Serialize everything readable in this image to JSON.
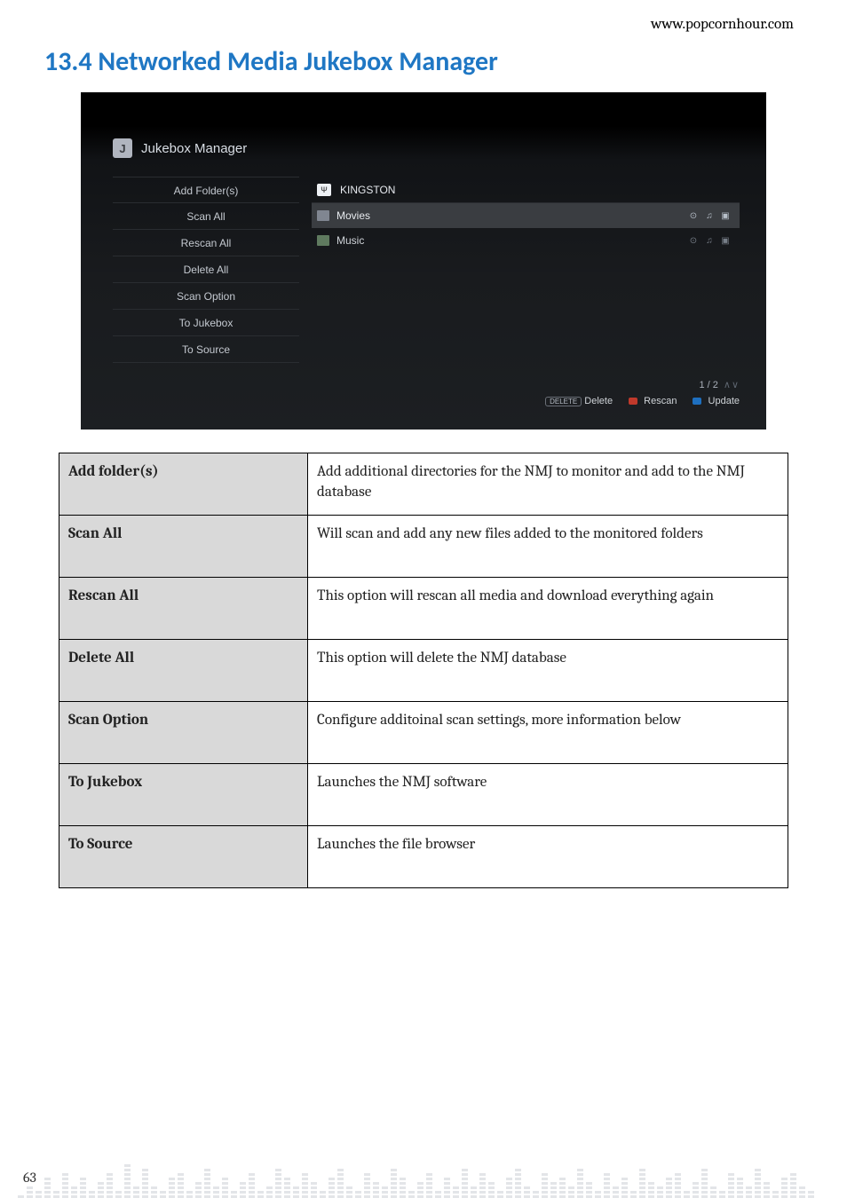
{
  "header": {
    "url": "www.popcornhour.com"
  },
  "section": {
    "heading": "13.4 Networked Media Jukebox Manager"
  },
  "screenshot": {
    "app_icon_letter": "J",
    "app_title": "Jukebox Manager",
    "menu": [
      "Add Folder(s)",
      "Scan All",
      "Rescan All",
      "Delete All",
      "Scan Option",
      "To Jukebox",
      "To Source"
    ],
    "drive": {
      "name": "KINGSTON"
    },
    "folders": [
      {
        "name": "Movies",
        "selected": true,
        "icons": [
          "video",
          "music",
          "photo"
        ]
      },
      {
        "name": "Music",
        "selected": false,
        "icons": [
          "video",
          "music",
          "photo"
        ]
      }
    ],
    "pager": {
      "text": "1 / 2",
      "arrows": "∧∨"
    },
    "legend": {
      "delete_key": "DELETE",
      "delete_label": "Delete",
      "rescan_label": "Rescan",
      "update_label": "Update"
    }
  },
  "table": [
    {
      "label": "Add folder(s)",
      "desc": "Add additional directories for the NMJ to monitor and add to the NMJ database"
    },
    {
      "label": "Scan All",
      "desc": "Will scan and add any new files added to the monitored folders"
    },
    {
      "label": "Rescan All",
      "desc": "This option will rescan all media and download everything again"
    },
    {
      "label": "Delete All",
      "desc": "This option will delete the NMJ database"
    },
    {
      "label": "Scan Option",
      "desc": "Configure additoinal scan settings, more information below"
    },
    {
      "label": "To Jukebox",
      "desc": "Launches the NMJ software"
    },
    {
      "label": "To Source",
      "desc": "Launches the file browser"
    }
  ],
  "footer": {
    "page_number": "63"
  },
  "icons": {
    "video_glyph": "⊙",
    "music_glyph": "♫",
    "photo_glyph": "▣"
  }
}
